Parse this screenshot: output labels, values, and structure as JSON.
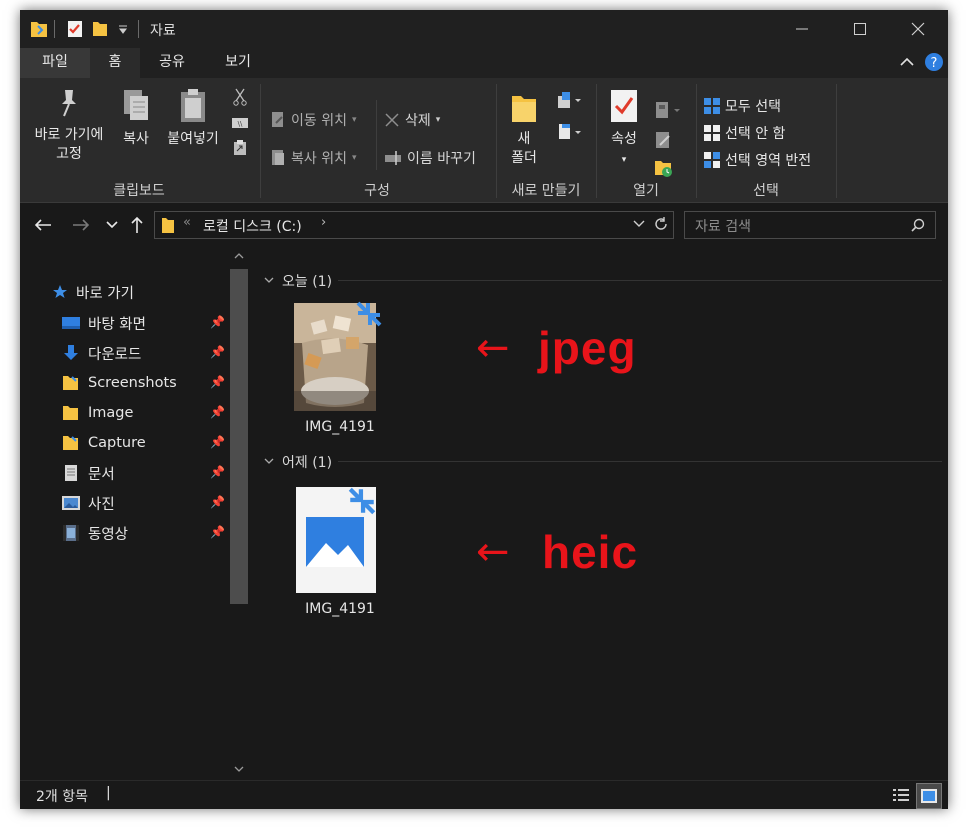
{
  "window": {
    "title": "자료"
  },
  "tabs": {
    "file": "파일",
    "home": "홈",
    "share": "공유",
    "view": "보기"
  },
  "ribbon": {
    "clipboard": {
      "pin_label_1": "바로 가기에",
      "pin_label_2": "고정",
      "copy": "복사",
      "paste": "붙여넣기",
      "group": "클립보드"
    },
    "organize": {
      "move_to": "이동 위치",
      "copy_to": "복사 위치",
      "delete": "삭제",
      "rename": "이름 바꾸기",
      "group": "구성"
    },
    "new": {
      "folder_1": "새",
      "folder_2": "폴더",
      "group": "새로 만들기"
    },
    "open": {
      "properties": "속성",
      "group": "열기"
    },
    "select": {
      "select_all": "모두 선택",
      "select_none": "선택 안 함",
      "invert": "선택 영역 반전",
      "group": "선택"
    }
  },
  "address": {
    "path": "로컬 디스크 (C:)",
    "search_placeholder": "자료 검색"
  },
  "nav": {
    "quick_access": "바로 가기",
    "items": [
      {
        "label": "바탕 화면",
        "icon": "desktop-icon"
      },
      {
        "label": "다운로드",
        "icon": "download-icon"
      },
      {
        "label": "Screenshots",
        "icon": "folder-icon"
      },
      {
        "label": "Image",
        "icon": "folder-icon"
      },
      {
        "label": "Capture",
        "icon": "folder-icon"
      },
      {
        "label": "문서",
        "icon": "documents-icon"
      },
      {
        "label": "사진",
        "icon": "pictures-icon"
      },
      {
        "label": "동영상",
        "icon": "videos-icon"
      }
    ]
  },
  "content": {
    "groups": [
      {
        "header": "오늘 (1)",
        "file": "IMG_4191",
        "annotation": "jpeg"
      },
      {
        "header": "어제 (1)",
        "file": "IMG_4191",
        "annotation": "heic"
      }
    ],
    "arrow": "←"
  },
  "status": {
    "count": "2개 항목"
  },
  "colors": {
    "annotation": "#e8141a",
    "folder": "#f5c242",
    "accent": "#3d8ee6"
  }
}
